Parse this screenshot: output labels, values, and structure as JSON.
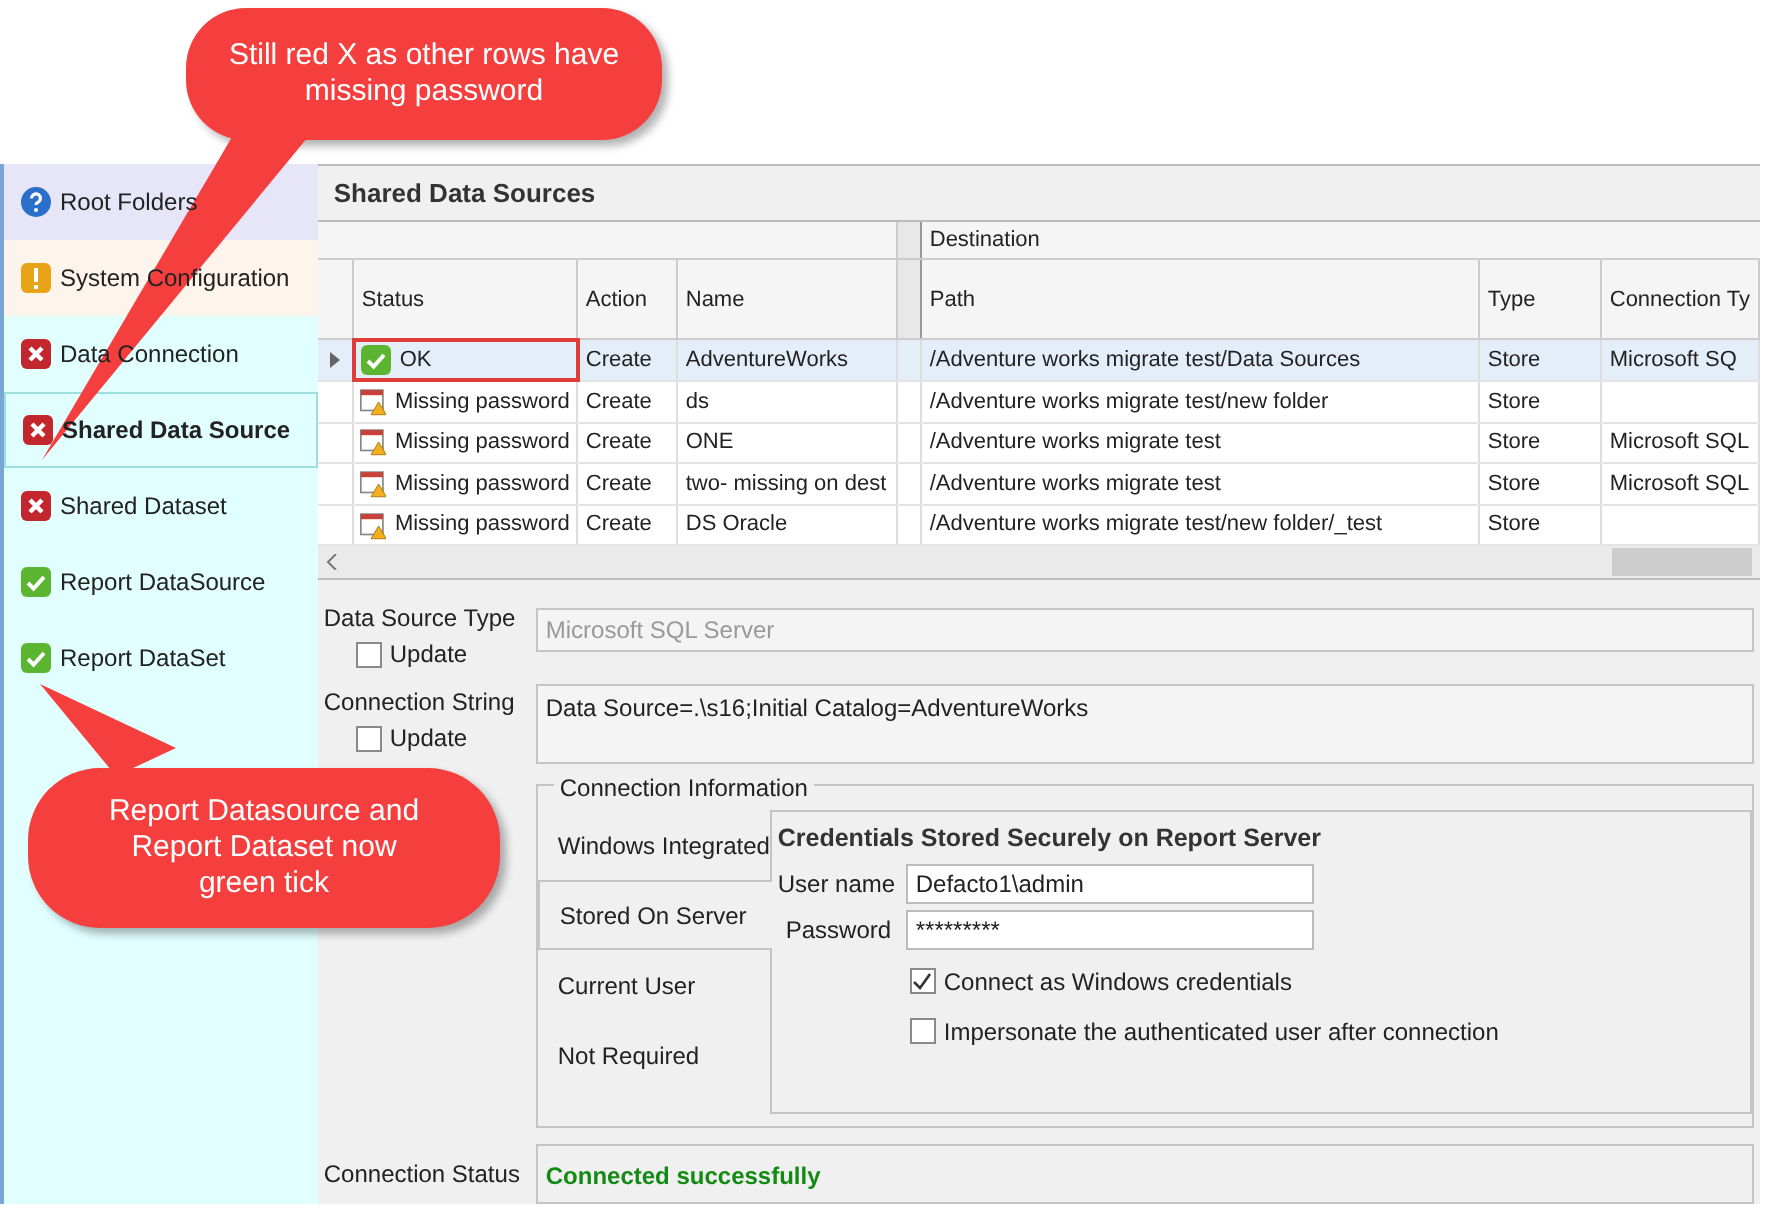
{
  "callouts": [
    {
      "text": "Still red X as other rows have missing password"
    },
    {
      "text": "Report Datasource and Report Dataset now green tick"
    }
  ],
  "sidebar": {
    "items": [
      {
        "label": "Root Folders",
        "kind": "help",
        "selected": false
      },
      {
        "label": "System Configuration",
        "kind": "warning",
        "selected": false
      },
      {
        "label": "Data Connection",
        "kind": "error",
        "selected": false
      },
      {
        "label": "Shared Data Source",
        "kind": "error",
        "selected": true
      },
      {
        "label": "Shared Dataset",
        "kind": "error",
        "selected": false
      },
      {
        "label": "Report DataSource",
        "kind": "ok",
        "selected": false
      },
      {
        "label": "Report DataSet",
        "kind": "ok",
        "selected": false
      }
    ]
  },
  "grid": {
    "title": "Shared Data Sources",
    "group_header": "Destination",
    "columns": [
      "Status",
      "Action",
      "Name",
      "Path",
      "Type",
      "Connection Ty"
    ],
    "rows": [
      {
        "kind": "ok",
        "selected": true,
        "highlighted": true,
        "cells": [
          "OK",
          "Create",
          "AdventureWorks",
          "/Adventure works migrate test/Data Sources",
          "Store",
          "Microsoft SQ"
        ]
      },
      {
        "kind": "missing",
        "selected": false,
        "highlighted": false,
        "cells": [
          "Missing password",
          "Create",
          "ds",
          "/Adventure works migrate test/new folder",
          "Store",
          ""
        ]
      },
      {
        "kind": "missing",
        "selected": false,
        "highlighted": false,
        "cells": [
          "Missing password",
          "Create",
          "ONE",
          "/Adventure works migrate test",
          "Store",
          "Microsoft SQL"
        ]
      },
      {
        "kind": "missing",
        "selected": false,
        "highlighted": false,
        "cells": [
          "Missing password",
          "Create",
          "two- missing on dest",
          "/Adventure works migrate test",
          "Store",
          "Microsoft SQL"
        ]
      },
      {
        "kind": "missing",
        "selected": false,
        "highlighted": false,
        "cells": [
          "Missing password",
          "Create",
          "DS Oracle",
          "/Adventure works migrate test/new folder/_test",
          "Store",
          ""
        ]
      }
    ]
  },
  "details": {
    "data_source_type": {
      "label": "Data Source Type",
      "update_label": "Update",
      "update_checked": false,
      "value": "Microsoft SQL Server",
      "disabled": true
    },
    "connection_string": {
      "label": "Connection String",
      "update_label": "Update",
      "update_checked": false,
      "value": "Data Source=.\\s16;Initial Catalog=AdventureWorks"
    },
    "connection_information": {
      "title": "Connection Information",
      "tabs": [
        {
          "label": "Windows Integrated",
          "selected": false
        },
        {
          "label": "Stored On Server",
          "selected": true
        },
        {
          "label": "Current User",
          "selected": false
        },
        {
          "label": "Not Required",
          "selected": false
        }
      ],
      "heading": "Credentials Stored Securely on Report Server",
      "user_name": {
        "label": "User name",
        "value": "Defacto1\\admin"
      },
      "password": {
        "label": "Password",
        "value": "*********"
      },
      "options": [
        {
          "label": "Connect as Windows credentials",
          "checked": true
        },
        {
          "label": "Impersonate the authenticated user after connection",
          "checked": false
        }
      ]
    },
    "connection_status": {
      "label": "Connection Status",
      "value": "Connected successfully"
    }
  }
}
